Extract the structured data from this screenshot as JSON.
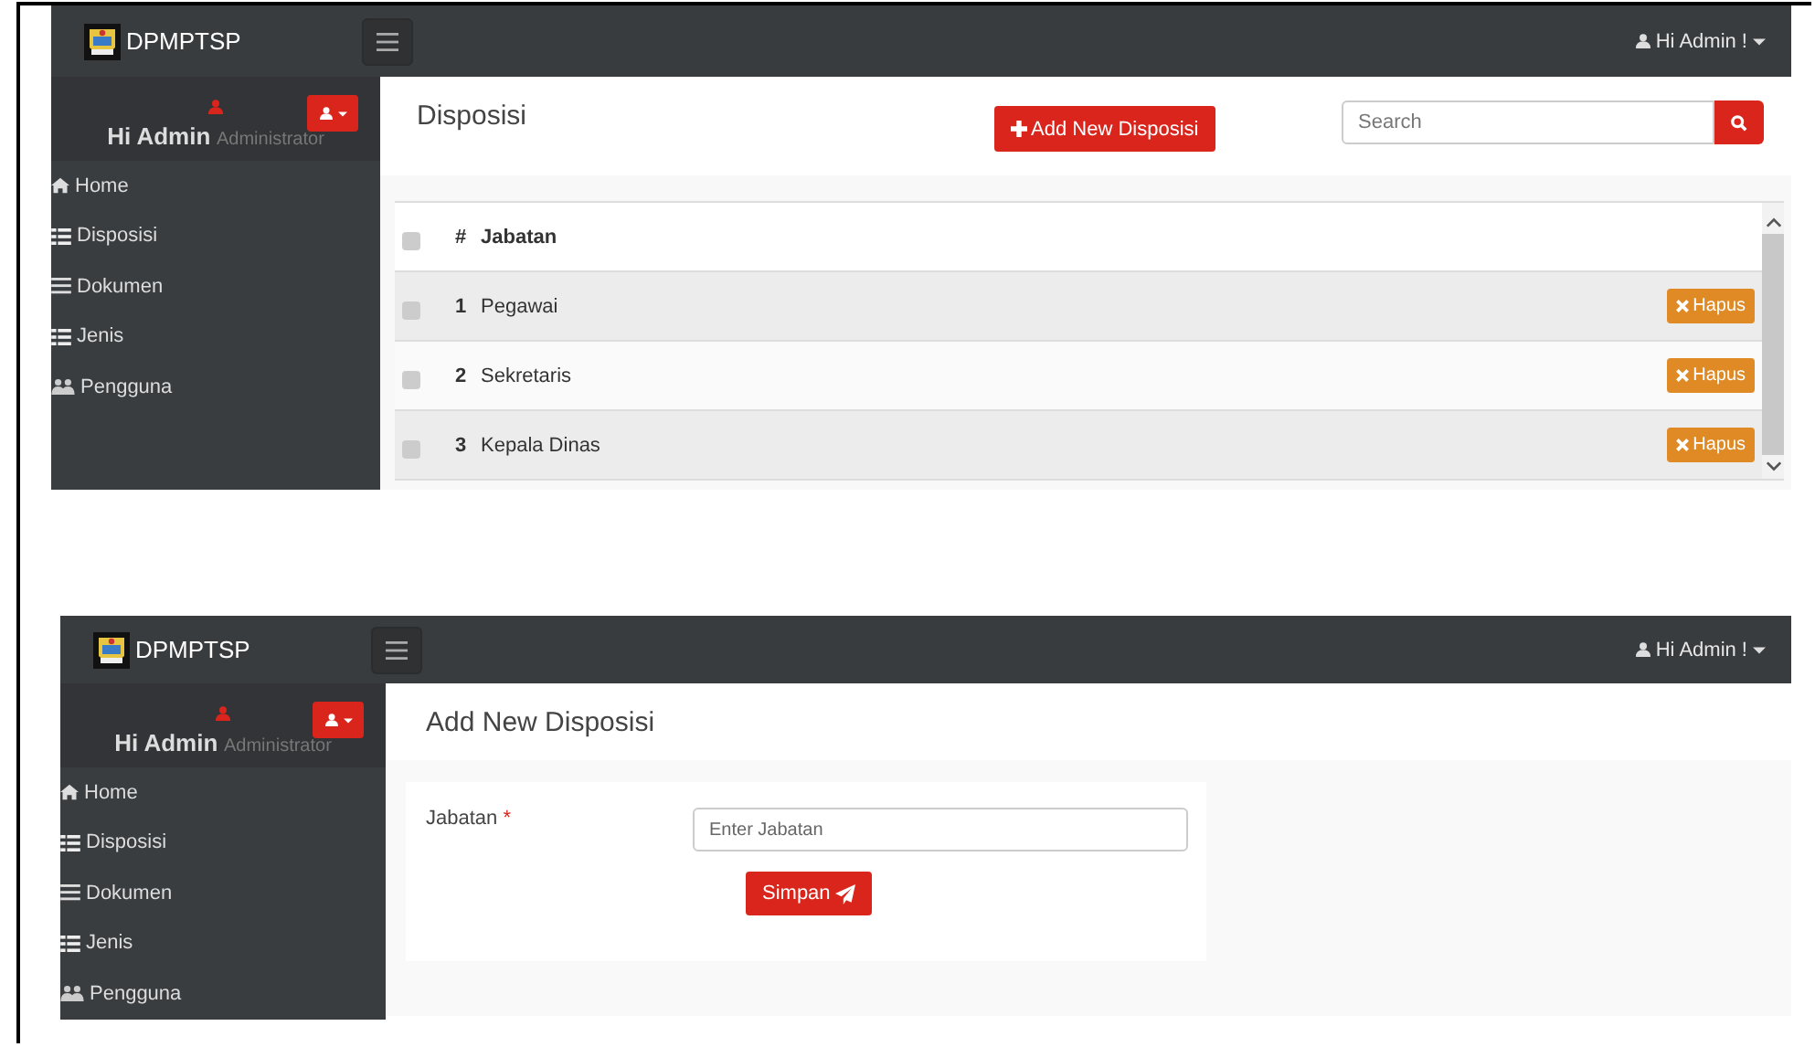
{
  "screens": [
    {
      "kind": "list",
      "navbar": {
        "brand": "DPMPTSP",
        "user_menu": "Hi Admin !"
      },
      "user_panel": {
        "name": "Hi Admin",
        "role": "Administrator"
      },
      "sidebar": {
        "items": [
          {
            "label": "Home",
            "kind": "home"
          },
          {
            "label": "Disposisi",
            "kind": "list"
          },
          {
            "label": "Dokumen",
            "kind": "bars"
          },
          {
            "label": "Jenis",
            "kind": "list"
          },
          {
            "label": "Pengguna",
            "kind": "users"
          }
        ]
      },
      "content": {
        "title": "Disposisi",
        "add_button": "Add New Disposisi",
        "search": {
          "placeholder": "Search"
        },
        "table": {
          "columns": [
            "#",
            "Jabatan"
          ],
          "header_checked": false,
          "rows": [
            {
              "number": "1",
              "jabatan": "Pegawai",
              "checked": false,
              "action": "Hapus"
            },
            {
              "number": "2",
              "jabatan": "Sekretaris",
              "checked": false,
              "action": "Hapus"
            },
            {
              "number": "3",
              "jabatan": "Kepala Dinas",
              "checked": false,
              "action": "Hapus"
            }
          ]
        }
      }
    },
    {
      "kind": "form",
      "navbar": {
        "brand": "DPMPTSP",
        "user_menu": "Hi Admin !"
      },
      "user_panel": {
        "name": "Hi Admin",
        "role": "Administrator"
      },
      "sidebar": {
        "items": [
          {
            "label": "Home",
            "kind": "home"
          },
          {
            "label": "Disposisi",
            "kind": "list"
          },
          {
            "label": "Dokumen",
            "kind": "bars"
          },
          {
            "label": "Jenis",
            "kind": "list"
          },
          {
            "label": "Pengguna",
            "kind": "users"
          }
        ]
      },
      "content": {
        "title": "Add New Disposisi",
        "field": {
          "label": "Jabatan",
          "required_mark": "*",
          "placeholder": "Enter Jabatan"
        },
        "submit_button": "Simpan"
      }
    }
  ]
}
